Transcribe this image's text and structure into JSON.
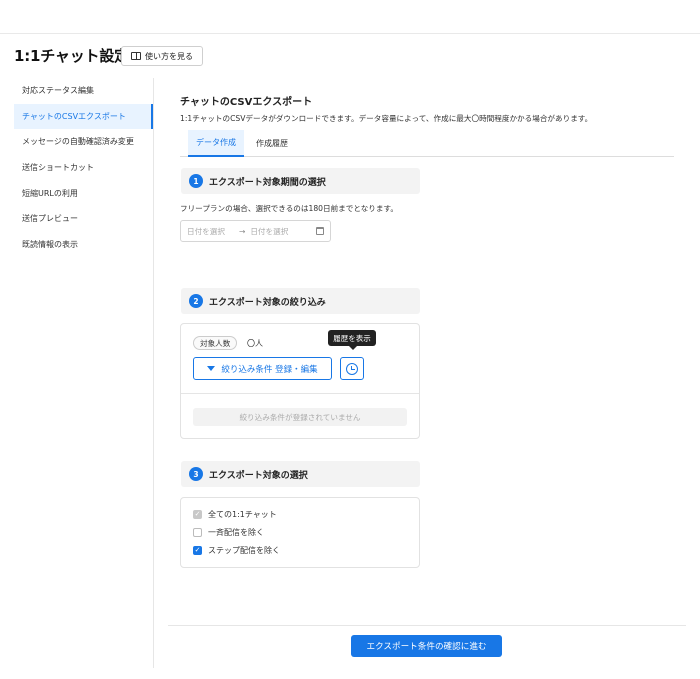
{
  "header": {
    "title": "1:1チャット設定",
    "help_label": "使い方を見る"
  },
  "sidebar": {
    "items": [
      {
        "label": "対応ステータス編集"
      },
      {
        "label": "チャットのCSVエクスポート"
      },
      {
        "label": "メッセージの自動確認済み変更"
      },
      {
        "label": "送信ショートカット"
      },
      {
        "label": "短縮URLの利用"
      },
      {
        "label": "送信プレビュー"
      },
      {
        "label": "既読情報の表示"
      }
    ],
    "active_index": 1
  },
  "main": {
    "title": "チャットのCSVエクスポート",
    "description": "1:1チャットのCSVデータがダウンロードできます。データ容量によって、作成に最大〇時間程度かかる場合があります。",
    "tabs": [
      {
        "label": "データ作成"
      },
      {
        "label": "作成履歴"
      }
    ],
    "active_tab": 0
  },
  "step1": {
    "number": "1",
    "title": "エクスポート対象期間の選択",
    "note": "フリープランの場合、選択できるのは180日前までとなります。",
    "start_placeholder": "日付を選択",
    "arrow": "→",
    "end_placeholder": "日付を選択"
  },
  "step2": {
    "number": "2",
    "title": "エクスポート対象の絞り込み",
    "target_label": "対象人数",
    "target_count": "〇人",
    "filter_button": "絞り込み条件 登録・編集",
    "history_tooltip": "履歴を表示",
    "empty_text": "絞り込み条件が登録されていません"
  },
  "step3": {
    "number": "3",
    "title": "エクスポート対象の選択",
    "options": [
      {
        "label": "全ての1:1チャット",
        "state": "disabled"
      },
      {
        "label": "一斉配信を除く",
        "state": "unchecked"
      },
      {
        "label": "ステップ配信を除く",
        "state": "checked"
      }
    ]
  },
  "footer": {
    "submit_label": "エクスポート条件の確認に進む"
  },
  "colors": {
    "accent": "#1877e6",
    "active_bg": "#e8f3ff"
  }
}
